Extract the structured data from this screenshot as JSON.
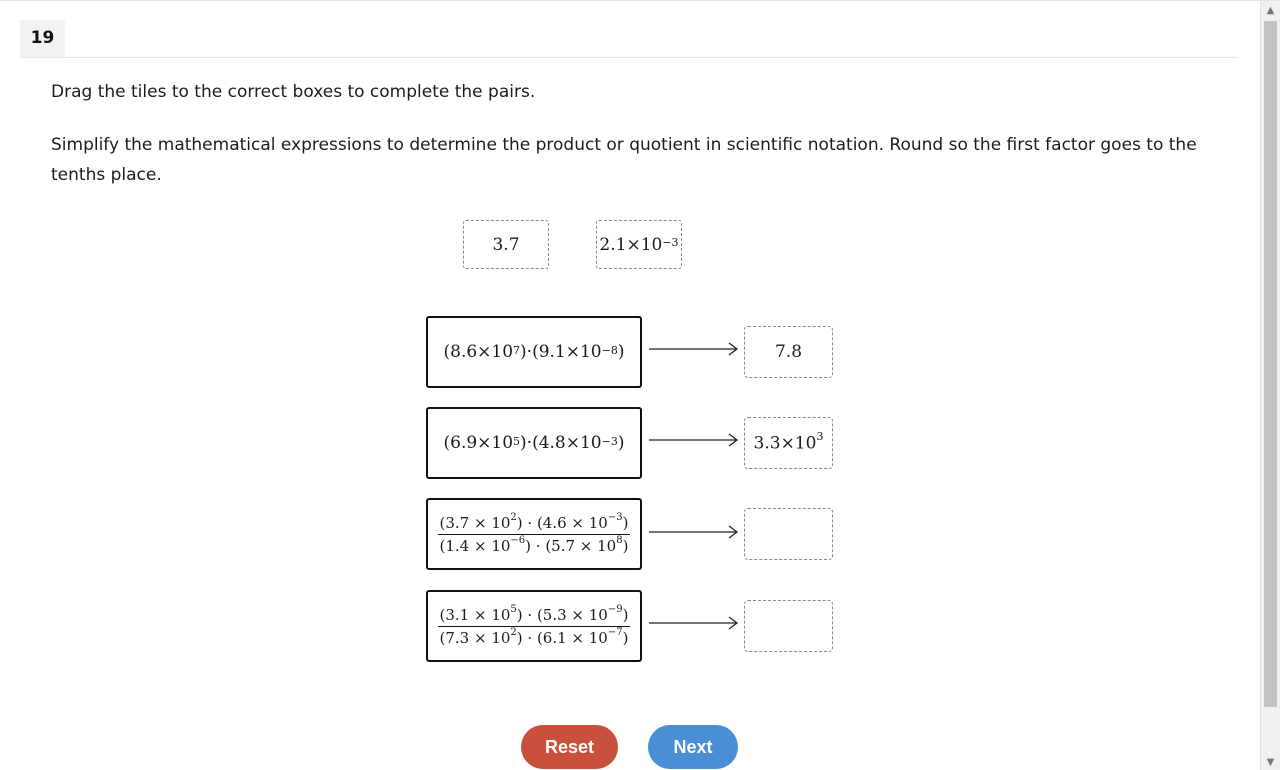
{
  "question": {
    "number": "19",
    "instruction": "Drag the tiles to the correct boxes to complete the pairs.",
    "prompt": "Simplify the mathematical expressions to determine the product or quotient in scientific notation. Round so the first factor goes to the tenths place."
  },
  "tiles": [
    {
      "mantissa": "3.7",
      "exponent": ""
    },
    {
      "mantissa": "2.1×10",
      "exponent": "−3"
    }
  ],
  "pairs": [
    {
      "expression": {
        "a": "(8.6×10",
        "a_exp": "7",
        "b": ")·(9.1×10",
        "b_exp": "−8",
        "c": ")"
      },
      "answer": {
        "mantissa": "7.8",
        "exponent": ""
      }
    },
    {
      "expression": {
        "a": "(6.9×10",
        "a_exp": "5",
        "b": ")·(4.8×10",
        "b_exp": "−3",
        "c": ")"
      },
      "answer": {
        "mantissa": "3.3×10",
        "exponent": "3"
      }
    },
    {
      "expression": {
        "num_a": "(3.7 × 10",
        "num_a_exp": "2",
        "num_b": ") · (4.6 × 10",
        "num_b_exp": "−3",
        "num_c": ")",
        "den_a": "(1.4 × 10",
        "den_a_exp": "−6",
        "den_b": ") · (5.7 × 10",
        "den_b_exp": "8",
        "den_c": ")"
      },
      "answer": null
    },
    {
      "expression": {
        "num_a": "(3.1 × 10",
        "num_a_exp": "5",
        "num_b": ") · (5.3 × 10",
        "num_b_exp": "−9",
        "num_c": ")",
        "den_a": "(7.3 × 10",
        "den_a_exp": "2",
        "den_b": ") · (6.1 × 10",
        "den_b_exp": "−7",
        "den_c": ")"
      },
      "answer": null
    }
  ],
  "buttons": {
    "reset": "Reset",
    "next": "Next"
  },
  "icons": {
    "scroll_up": "scroll-up-arrow",
    "scroll_down": "scroll-down-arrow",
    "pair_arrow": "right-arrow"
  },
  "colors": {
    "reset": "#c9503a",
    "next": "#4a8fd6"
  }
}
